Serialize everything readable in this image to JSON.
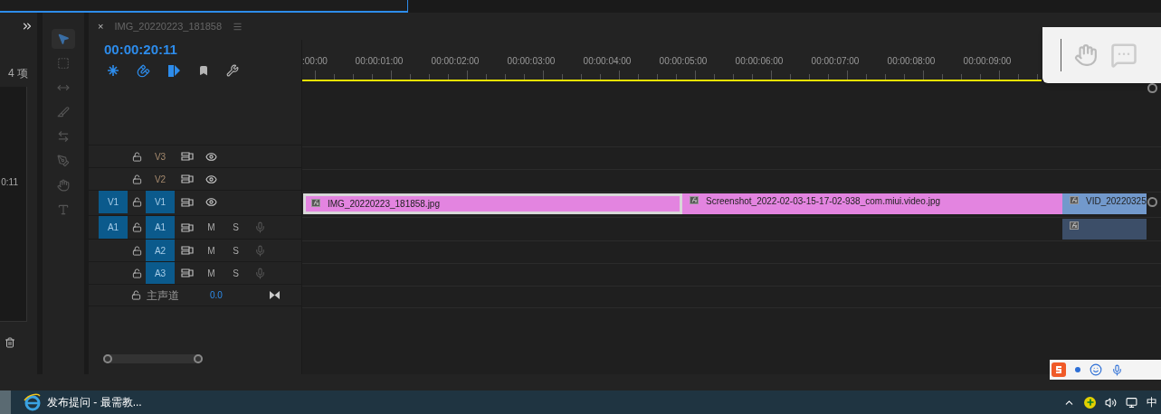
{
  "project_panel": {
    "count": "4 项",
    "time": "0:11"
  },
  "tools": [
    {
      "kind": "select",
      "selected": true
    },
    {
      "kind": "track_select",
      "selected": false
    },
    {
      "kind": "ripple",
      "selected": false
    },
    {
      "kind": "razor",
      "selected": false
    },
    {
      "kind": "slip",
      "selected": false
    },
    {
      "kind": "pen",
      "selected": false
    },
    {
      "kind": "hand",
      "selected": false
    },
    {
      "kind": "type",
      "selected": false
    }
  ],
  "sequence": {
    "close": "×",
    "title": "IMG_20220223_181858",
    "timecode": "00:00:20:11",
    "toolbar": [
      {
        "kind": "nest",
        "on": true
      },
      {
        "kind": "snap",
        "on": true
      },
      {
        "kind": "linked",
        "on": true
      },
      {
        "kind": "marker",
        "on": false
      },
      {
        "kind": "settings",
        "on": false
      }
    ],
    "ruler": [
      ":00:00",
      "00:00:01:00",
      "00:00:02:00",
      "00:00:03:00",
      "00:00:04:00",
      "00:00:05:00",
      "00:00:06:00",
      "00:00:07:00",
      "00:00:08:00",
      "00:00:09:00"
    ],
    "tracks": [
      {
        "kind": "video",
        "name": "V3",
        "targeted": false,
        "locked": false,
        "visible": true
      },
      {
        "kind": "video",
        "name": "V2",
        "targeted": false,
        "locked": false,
        "visible": true
      },
      {
        "kind": "video",
        "name": "V1",
        "source_patch": "V1",
        "targeted": true,
        "locked": false,
        "visible": true,
        "clips": [
          {
            "name": "IMG_20220223_181858.jpg",
            "selected": true
          },
          {
            "name": "Screenshot_2022-02-03-15-17-02-938_com.miui.video.jpg",
            "selected": false
          },
          {
            "name": "VID_20220325",
            "selected": false
          }
        ]
      },
      {
        "kind": "audio",
        "name": "A1",
        "source_patch": "A1",
        "targeted": true,
        "locked": false,
        "mute": "M",
        "solo": "S",
        "clips": [
          {
            "selected": false
          }
        ]
      },
      {
        "kind": "audio",
        "name": "A2",
        "targeted": true,
        "locked": false,
        "mute": "M",
        "solo": "S"
      },
      {
        "kind": "audio",
        "name": "A3",
        "targeted": true,
        "locked": false,
        "mute": "M",
        "solo": "S"
      }
    ],
    "master": {
      "label": "主声道",
      "value": "0.0"
    }
  },
  "taskbar": {
    "window_title": "发布提问 - 最需教...",
    "ime": "中"
  }
}
